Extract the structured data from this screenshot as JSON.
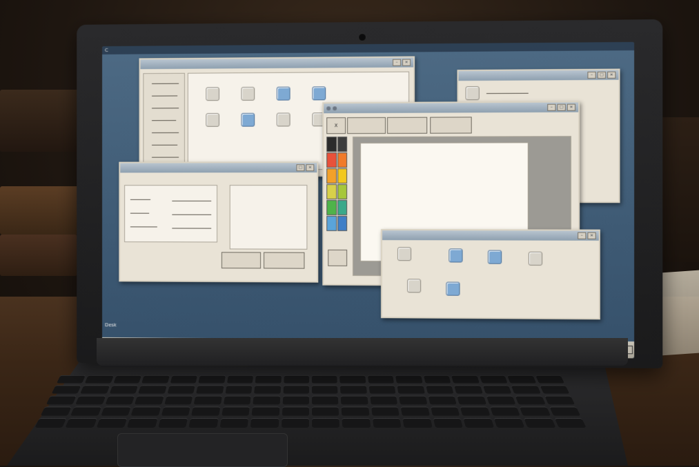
{
  "screen": {
    "top_label": "C",
    "desktop_label": "Desk"
  },
  "windows": {
    "explorer": {
      "header": "",
      "tiles": [
        "file-icon",
        "file-icon",
        "file-icon",
        "folder-icon",
        "file-icon",
        "file-icon",
        "file-icon",
        "file-icon"
      ]
    },
    "paint": {
      "title": "",
      "tools": [
        "X",
        "",
        "",
        ""
      ],
      "palette": [
        "#2b2b2b",
        "#3d3d3d",
        "#e8513a",
        "#f07b2a",
        "#f3a12a",
        "#f2c81d",
        "#d8d04a",
        "#a6c73a",
        "#4fb34a",
        "#3aa98a",
        "#5aa4da",
        "#3f7fc7"
      ]
    },
    "dialog": {
      "title": "",
      "buttons": [
        "",
        ""
      ]
    },
    "back_right": {
      "title": ""
    },
    "icons_window": {
      "title": ""
    }
  },
  "taskbar": {
    "start": ""
  }
}
